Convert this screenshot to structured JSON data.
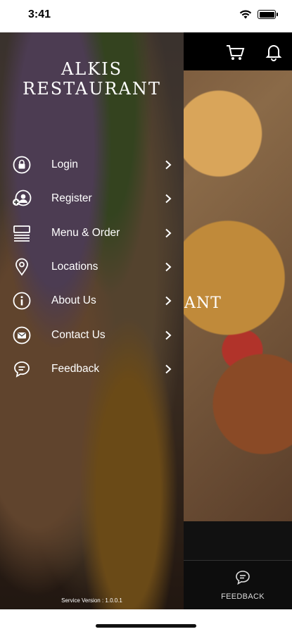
{
  "status_bar": {
    "time": "3:41"
  },
  "main": {
    "brand_fragment": "ANT",
    "bottom_nav": {
      "feedback_label": "FEEDBACK"
    }
  },
  "drawer": {
    "brand_line1": "ALKIS",
    "brand_line2": "RESTAURANT",
    "menu": [
      {
        "label": "Login",
        "icon": "lock-icon"
      },
      {
        "label": "Register",
        "icon": "register-user-icon"
      },
      {
        "label": "Menu & Order",
        "icon": "menu-list-icon"
      },
      {
        "label": "Locations",
        "icon": "location-pin-icon"
      },
      {
        "label": "About Us",
        "icon": "info-icon"
      },
      {
        "label": "Contact Us",
        "icon": "mail-icon"
      },
      {
        "label": "Feedback",
        "icon": "chat-bubble-icon"
      }
    ],
    "version": "Service Version : 1.0.0.1"
  }
}
